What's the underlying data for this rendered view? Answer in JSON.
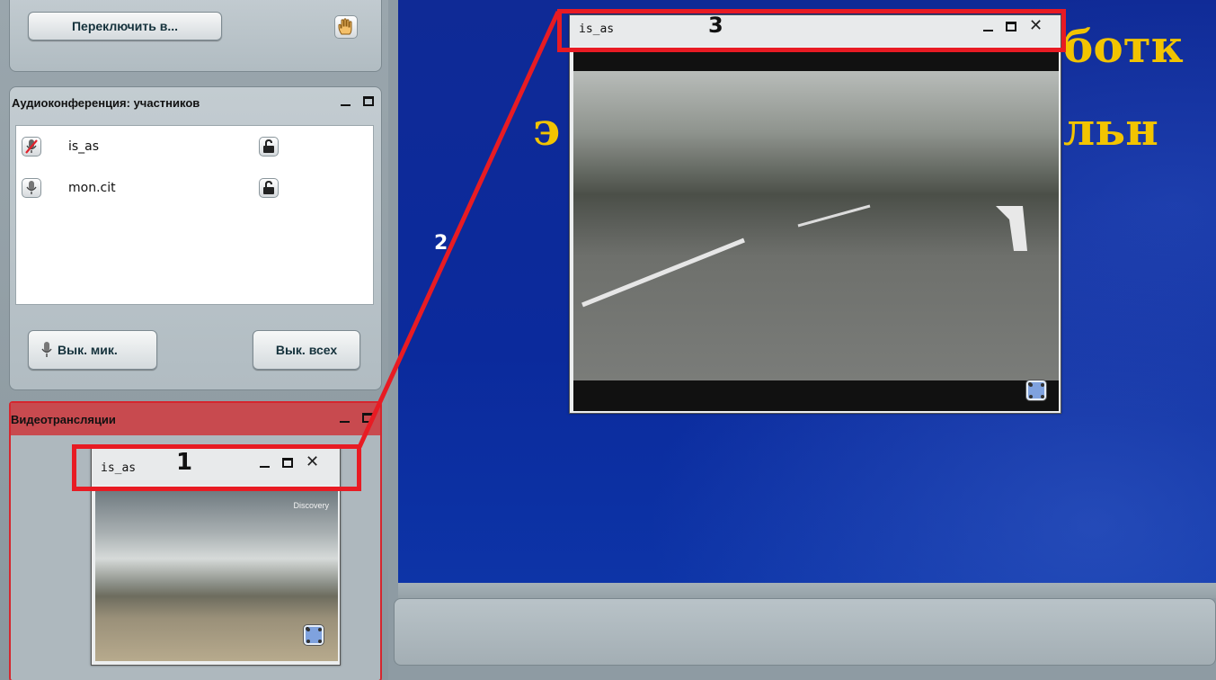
{
  "toolbar": {
    "switch_button": "Переключить в..."
  },
  "audio_panel": {
    "title": "Аудиоконференция:  участников",
    "participants": [
      {
        "name": "is_as",
        "mic": "muted-mic-icon"
      },
      {
        "name": "mon.cit",
        "mic": "mic-icon"
      }
    ],
    "mute_mic_button": "Вык. мик.",
    "mute_all_button": "Вык. всех"
  },
  "video_panel": {
    "title": "Видеотрансляции",
    "small_window": {
      "title": "is_as",
      "watermark": "Discovery"
    }
  },
  "main": {
    "slide_line1": "ботк",
    "slide_line2_left": "э",
    "slide_line2_right": "льн",
    "video_window": {
      "title": "is_as"
    }
  },
  "annotations": {
    "label1": "1",
    "label2": "2",
    "label3": "3"
  },
  "colors": {
    "highlight": "#e81b23",
    "slide_bg": "#0b2a9c",
    "slide_text": "#f2c400"
  }
}
